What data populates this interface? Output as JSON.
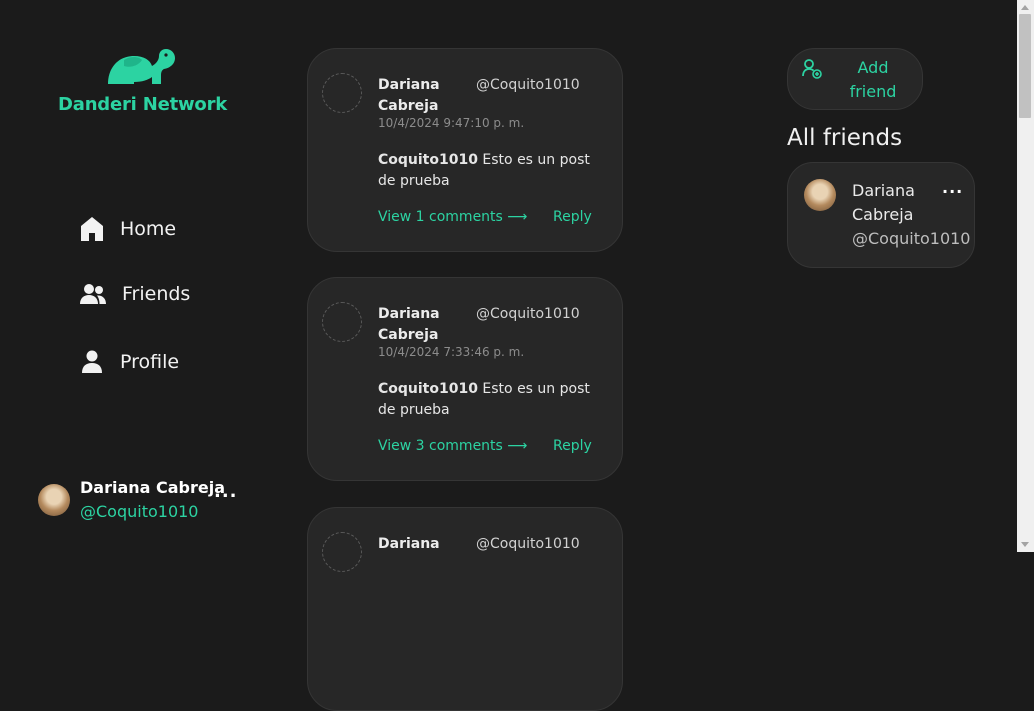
{
  "brand": {
    "name": "Danderi Network",
    "icon": "elephant-logo-icon",
    "color": "#2cd3a2"
  },
  "nav": [
    {
      "label": "Home",
      "icon": "home-icon"
    },
    {
      "label": "Friends",
      "icon": "friends-icon"
    },
    {
      "label": "Profile",
      "icon": "profile-icon"
    }
  ],
  "current_user": {
    "name": "Dariana Cabreja",
    "handle": "@Coquito1010",
    "menu": "..."
  },
  "posts": [
    {
      "author": "Dariana Cabreja",
      "handle": "@Coquito1010",
      "date": "10/4/2024 9:47:10 p. m.",
      "body_user": "Coquito1010",
      "body_text": " Esto es un post de prueba",
      "comments_link": "View 1 comments",
      "arrow": "⟶",
      "reply": "Reply"
    },
    {
      "author": "Dariana Cabreja",
      "handle": "@Coquito1010",
      "date": "10/4/2024 7:33:46 p. m.",
      "body_user": "Coquito1010",
      "body_text": " Esto es un post de prueba",
      "comments_link": "View 3 comments",
      "arrow": "⟶",
      "reply": "Reply"
    },
    {
      "author": "Dariana",
      "handle": "@Coquito1010"
    }
  ],
  "add_friend": {
    "label": "Add friend",
    "icon": "add-user-icon"
  },
  "friends": {
    "title": "All friends",
    "items": [
      {
        "name": "Dariana Cabreja",
        "handle": "@Coquito1010",
        "menu": "..."
      }
    ]
  },
  "colors": {
    "background": "#1b1b1b",
    "card": "#272727",
    "accent": "#2cd3a2"
  }
}
